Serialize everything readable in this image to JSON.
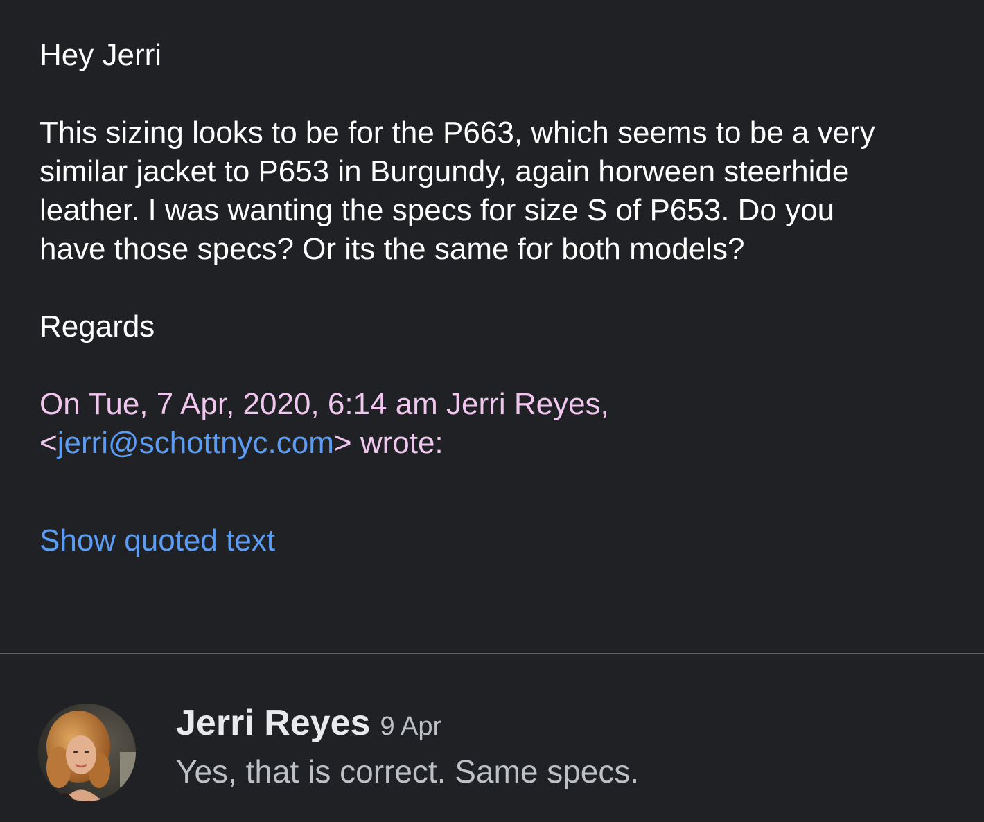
{
  "message": {
    "greeting": "Hey Jerri",
    "body_lines": [
      "This sizing looks to be for the P663, which seems to be a very",
      "similar jacket to P653 in Burgundy, again horween steerhide",
      "leather. I was wanting the specs for size S of P653. Do you",
      "have those specs? Or its the same for both models?"
    ],
    "signoff": "Regards",
    "quote_attribution": {
      "line1": "On Tue, 7 Apr, 2020, 6:14 am Jerri Reyes,",
      "email_open": "<",
      "email": "jerri@schottnyc.com",
      "email_close": ">",
      "suffix": " wrote:"
    },
    "show_quoted_label": "Show quoted text"
  },
  "reply": {
    "sender_name": "Jerri Reyes",
    "date": "9 Apr",
    "snippet": "Yes, that is correct. Same specs.",
    "avatar": "profile-photo"
  },
  "colors": {
    "background": "#202124",
    "text": "#ffffff",
    "quote_attribution": "#f1c7ef",
    "link": "#5b9cf5",
    "secondary_text": "#bdc1c6",
    "divider": "#5f6368"
  }
}
